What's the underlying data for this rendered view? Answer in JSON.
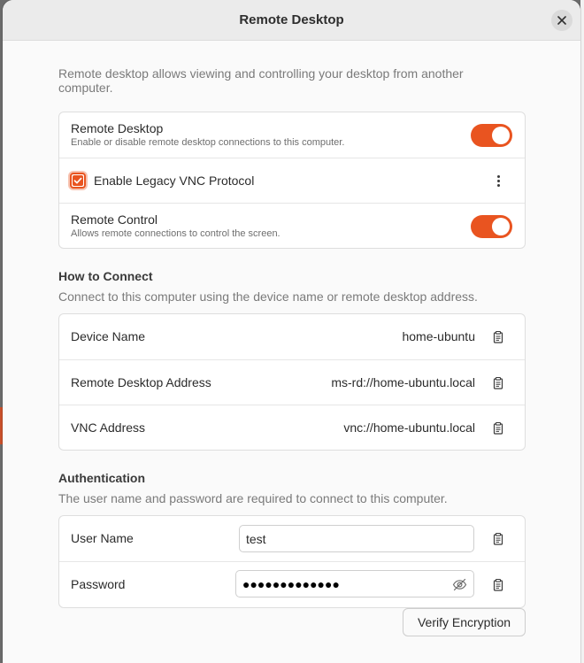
{
  "dialog": {
    "title": "Remote Desktop",
    "intro": "Remote desktop allows viewing and controlling your desktop from another computer."
  },
  "sharing": {
    "remote_desktop": {
      "title": "Remote Desktop",
      "subtitle": "Enable or disable remote desktop connections to this computer.",
      "enabled": true
    },
    "legacy_vnc": {
      "label": "Enable Legacy VNC Protocol",
      "checked": true
    },
    "remote_control": {
      "title": "Remote Control",
      "subtitle": "Allows remote connections to control the screen.",
      "enabled": true
    }
  },
  "how_to_connect": {
    "title": "How to Connect",
    "subtitle": "Connect to this computer using the device name or remote desktop address.",
    "rows": [
      {
        "label": "Device Name",
        "value": "home-ubuntu"
      },
      {
        "label": "Remote Desktop Address",
        "value": "ms-rd://home-ubuntu.local"
      },
      {
        "label": "VNC Address",
        "value": "vnc://home-ubuntu.local"
      }
    ]
  },
  "authentication": {
    "title": "Authentication",
    "subtitle": "The user name and password are required to connect to this computer.",
    "username_label": "User Name",
    "username_value": "test",
    "password_label": "Password",
    "password_masked": "●●●●●●●●●●●●●"
  },
  "verify_button": "Verify Encryption",
  "colors": {
    "accent": "#e95420",
    "card_bg": "#ffffff",
    "window_bg": "#fafafa",
    "header_bg": "#ebebeb"
  },
  "icons": {
    "close": "close-icon",
    "copy": "copy-icon",
    "more": "more-vertical-icon",
    "reveal": "eye-slash-icon",
    "check": "check-icon"
  }
}
